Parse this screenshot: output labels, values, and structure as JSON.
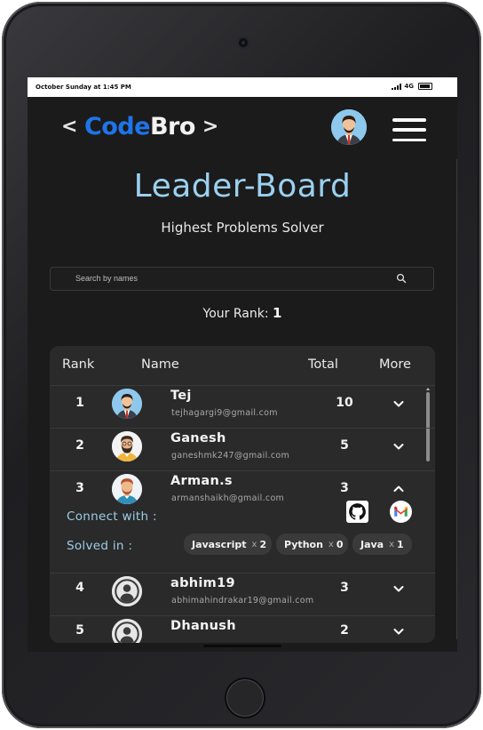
{
  "status_bar": {
    "time": "October Sunday at 1:45 PM",
    "network": "4G"
  },
  "header": {
    "logo_left": "<",
    "logo_code": "Code",
    "logo_bro": "Bro",
    "logo_right": ">"
  },
  "page": {
    "title": "Leader-Board",
    "subtitle": "Highest Problems Solver"
  },
  "search": {
    "placeholder": "Search by names"
  },
  "your_rank": {
    "label": "Your Rank:",
    "value": "1"
  },
  "table": {
    "headers": {
      "rank": "Rank",
      "name": "Name",
      "total": "Total",
      "more": "More"
    },
    "rows": [
      {
        "rank": "1",
        "name": "Tej",
        "email": "tejhagargi9@gmail.com",
        "total": "10",
        "expanded": false,
        "avatar": "man-red-tie"
      },
      {
        "rank": "2",
        "name": "Ganesh",
        "email": "ganeshmk247@gmail.com",
        "total": "5",
        "expanded": false,
        "avatar": "bearded-man"
      },
      {
        "rank": "3",
        "name": "Arman.s",
        "email": "armanshaikh@gmail.com",
        "total": "3",
        "expanded": true,
        "avatar": "man-beard-red-hair"
      },
      {
        "rank": "4",
        "name": "abhim19",
        "email": "abhimahindrakar19@gmail.com",
        "total": "3",
        "expanded": false,
        "avatar": "default-user"
      },
      {
        "rank": "5",
        "name": "Dhanush",
        "email": "",
        "total": "2",
        "expanded": false,
        "avatar": "default-user"
      }
    ],
    "expanded_detail": {
      "connect_label": "Connect with :",
      "solved_label": "Solved in :",
      "icons": [
        "github-icon",
        "gmail-icon"
      ],
      "languages": [
        {
          "name": "Javascript",
          "times": "x",
          "count": "2"
        },
        {
          "name": "Python",
          "times": "x",
          "count": "0"
        },
        {
          "name": "Java",
          "times": "x",
          "count": "1"
        }
      ]
    }
  },
  "colors": {
    "accent": "#9bd0ef",
    "brand_blue": "#1f74e8",
    "background": "#1b1b1b",
    "card": "#2a2a2a"
  }
}
